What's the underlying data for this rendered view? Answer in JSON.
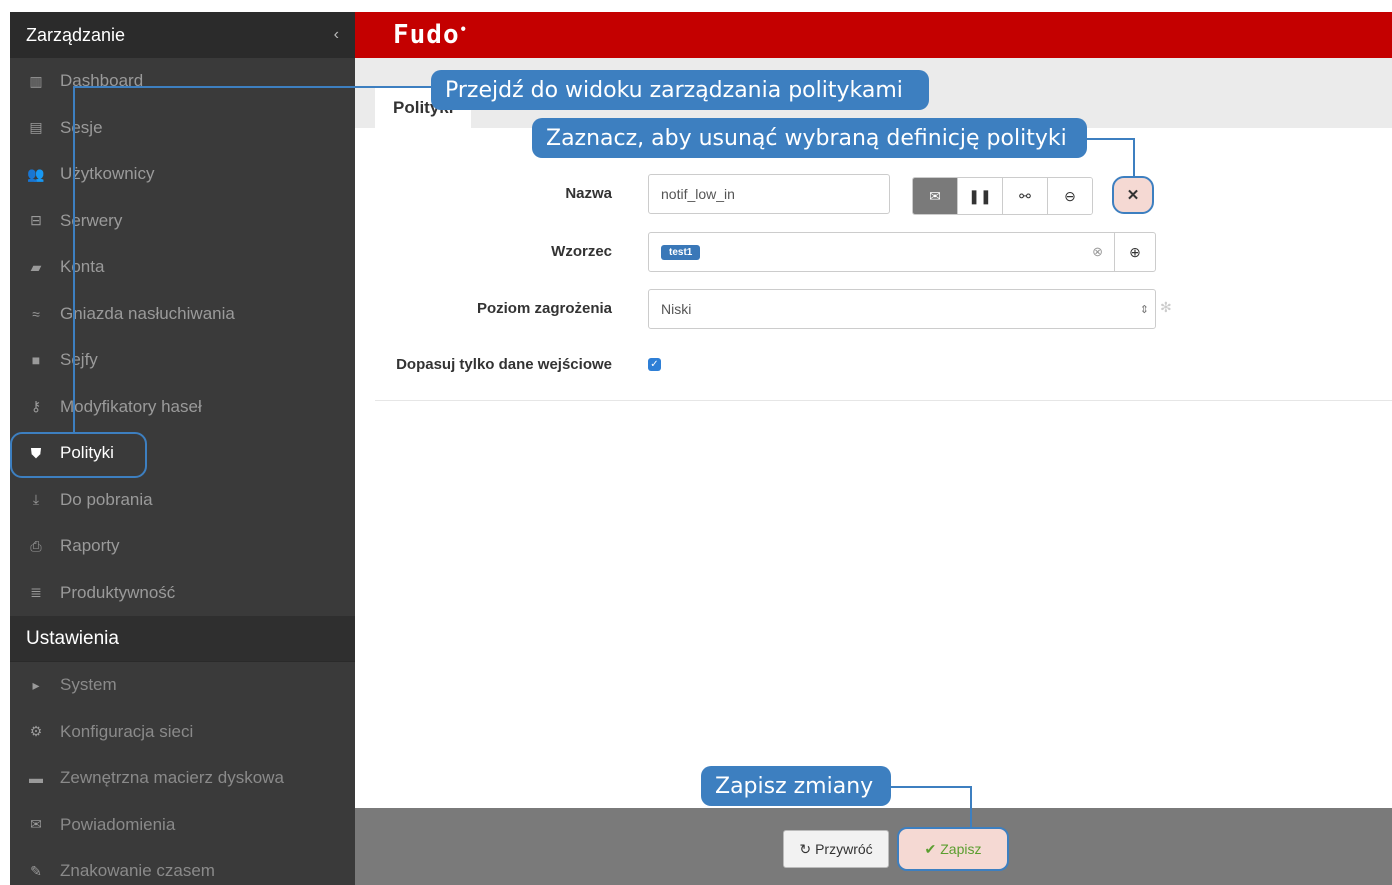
{
  "sidebar": {
    "title": "Zarządzanie",
    "collapse_glyph": "‹",
    "items": [
      {
        "label": "Dashboard",
        "icon": "▥"
      },
      {
        "label": "Sesje",
        "icon": "▤"
      },
      {
        "label": "Użytkownicy",
        "icon": "👥"
      },
      {
        "label": "Serwery",
        "icon": "⊟"
      },
      {
        "label": "Konta",
        "icon": "▰"
      },
      {
        "label": "Gniazda nasłuchiwania",
        "icon": "≈"
      },
      {
        "label": "Sejfy",
        "icon": "■"
      },
      {
        "label": "Modyfikatory haseł",
        "icon": "⚷"
      },
      {
        "label": "Polityki",
        "icon": "⛊"
      },
      {
        "label": "Do pobrania",
        "icon": "⤓"
      },
      {
        "label": "Raporty",
        "icon": "⎙"
      },
      {
        "label": "Produktywność",
        "icon": "≣"
      }
    ],
    "settings_title": "Ustawienia",
    "settings_items": [
      {
        "label": "System",
        "icon": "▸"
      },
      {
        "label": "Konfiguracja sieci",
        "icon": "⚙"
      },
      {
        "label": "Zewnętrzna macierz dyskowa",
        "icon": "▬"
      },
      {
        "label": "Powiadomienia",
        "icon": "✉"
      },
      {
        "label": "Znakowanie czasem",
        "icon": "✎"
      }
    ]
  },
  "topbar": {
    "logo": "Fudo",
    "logo_mark": "•"
  },
  "tabs": {
    "active": "Polityki"
  },
  "form": {
    "name_label": "Nazwa",
    "name_value": "notif_low_in",
    "pattern_label": "Wzorzec",
    "pattern_tag": "test1",
    "threat_label": "Poziom zagrożenia",
    "threat_value": "Niski",
    "match_label": "Dopasuj tylko dane wejściowe",
    "match_checked": true
  },
  "action_icons": [
    "mail-icon",
    "pause-icon",
    "disconnect-icon",
    "block-icon"
  ],
  "footer": {
    "reset_label": "Przywróć",
    "save_label": "Zapisz"
  },
  "callouts": {
    "policies_view": "Przejdź do widoku zarządzania politykami",
    "delete_policy": "Zaznacz, aby usunąć wybraną definicję polityki",
    "save_changes": "Zapisz zmiany"
  },
  "colors": {
    "accent_red": "#c40000",
    "callout_blue": "#3d7fc0",
    "sidebar_bg": "#3a3a3a"
  }
}
